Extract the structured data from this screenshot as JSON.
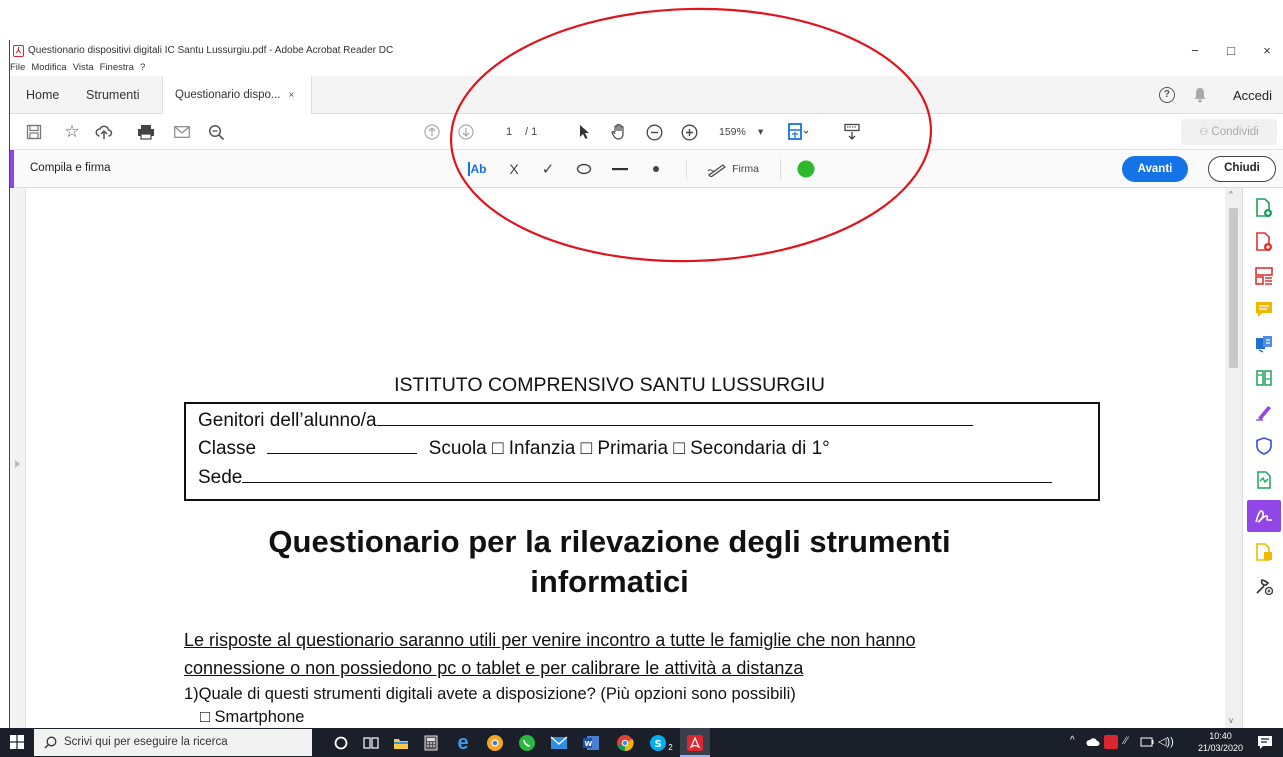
{
  "window": {
    "title": "Questionario dispositivi digitali IC Santu Lussurgiu.pdf - Adobe Acrobat Reader DC",
    "controls": {
      "minimize": "−",
      "maximize": "□",
      "close": "×"
    }
  },
  "menu": {
    "items": [
      "File",
      "Modifica",
      "Vista",
      "Finestra",
      "?"
    ]
  },
  "tabs": {
    "home": "Home",
    "tools": "Strumenti",
    "document": "Questionario dispo...",
    "close_glyph": "×",
    "signin": "Accedi",
    "help_glyph": "?"
  },
  "toolbar": {
    "page_current": "1",
    "page_total": "/ 1",
    "zoom": "159%",
    "zoom_arrow": "▾",
    "share": "Condividi",
    "share_icon": "person-add-icon"
  },
  "fillsign": {
    "label": "Compila e firma",
    "text_tool": "Ab",
    "cross_tool": "X",
    "check_tool": "✓",
    "sign": "Firma",
    "color": "#2db82d",
    "next": "Avanti",
    "close": "Chiudi",
    "accent": "#9146e6"
  },
  "document": {
    "heading": "ISTITUTO COMPRENSIVO SANTU LUSSURGIU",
    "parents_label": "Genitori dell’alunno/a",
    "class_label": "Classe",
    "school_line": "Scuola □ Infanzia    □ Primaria □ Secondaria di 1°",
    "sede_label": "Sede",
    "title_line1": "Questionario per la rilevazione degli strumenti",
    "title_line2": "informatici",
    "intro_line1": "Le risposte al  questionario saranno utili per venire incontro a tutte le famiglie che non hanno",
    "intro_line2": "connessione o non possiedono pc o tablet e per calibrare le attività a distanza",
    "question1": "1)Quale di questi strumenti digitali avete a disposizione? (Più opzioni sono possibili)",
    "option1": "□ Smartphone"
  },
  "taskbar": {
    "search_placeholder": "Scrivi qui per eseguire la ricerca",
    "time": "10:40",
    "date": "21/03/2020",
    "skype_badge": "2"
  },
  "colors": {
    "primary_button": "#1473e6",
    "annotation": "#e0141e",
    "acrobat_red": "#d9262f",
    "taskbar": "#1b1f2a"
  }
}
